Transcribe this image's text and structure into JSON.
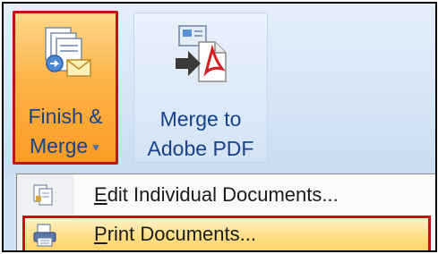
{
  "ribbon": {
    "finish_merge": {
      "label_line1": "Finish &",
      "label_line2": "Merge",
      "dropdown_glyph": "▼",
      "icon": "finish-merge-icon"
    },
    "merge_pdf": {
      "label_line1": "Merge to",
      "label_line2": "Adobe PDF",
      "icon": "merge-to-pdf-icon"
    }
  },
  "menu": {
    "items": [
      {
        "accel": "E",
        "rest": "dit Individual Documents...",
        "icon": "edit-documents-icon"
      },
      {
        "accel": "P",
        "rest": "rint Documents...",
        "icon": "print-documents-icon"
      }
    ]
  },
  "colors": {
    "highlight_border": "#c51313",
    "button_orange": "#fb9c24",
    "label_blue": "#15428b",
    "menu_hover": "#ffe08a"
  }
}
